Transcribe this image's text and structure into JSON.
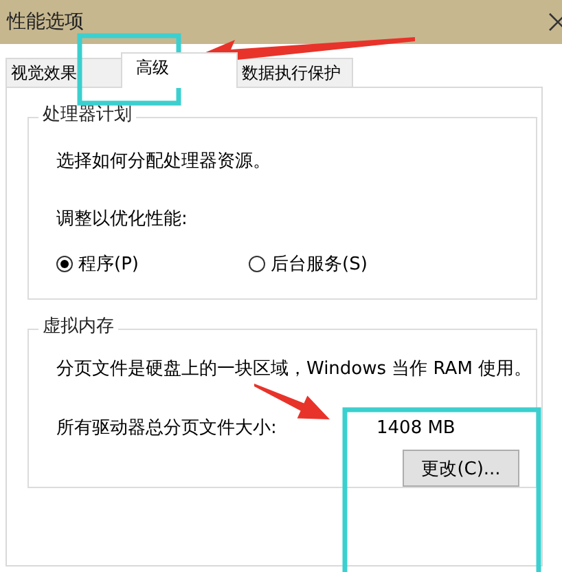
{
  "window": {
    "title": "性能选项"
  },
  "tabs": [
    {
      "label": "视觉效果",
      "selected": false
    },
    {
      "label": "高级",
      "selected": true
    },
    {
      "label": "数据执行保护",
      "selected": false
    }
  ],
  "processor_scheduling": {
    "title": "处理器计划",
    "description": "选择如何分配处理器资源。",
    "prompt": "调整以优化性能:",
    "options": [
      {
        "label": "程序(P)",
        "selected": true
      },
      {
        "label": "后台服务(S)",
        "selected": false
      }
    ]
  },
  "virtual_memory": {
    "title": "虚拟内存",
    "description": "分页文件是硬盘上的一块区域，Windows 当作 RAM 使用。",
    "size_label": "所有驱动器总分页文件大小:",
    "size_value": "1408 MB",
    "button": "更改(C)..."
  }
}
